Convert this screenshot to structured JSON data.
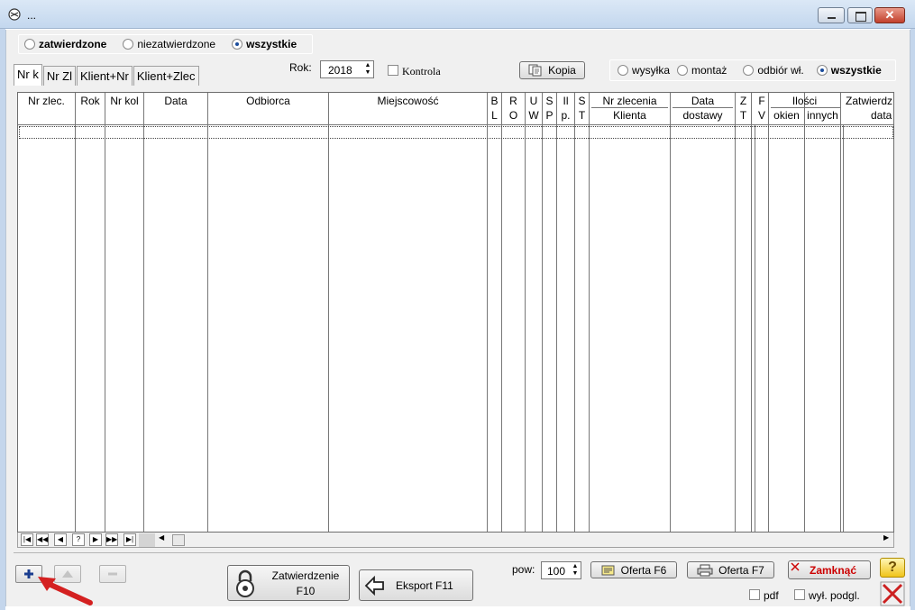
{
  "window": {
    "title": "..."
  },
  "approval_filter": {
    "options": [
      {
        "label": "zatwierdzone",
        "selected": false,
        "bold": true
      },
      {
        "label": "niezatwierdzone",
        "selected": false,
        "bold": false
      },
      {
        "label": "wszystkie",
        "selected": true,
        "bold": true
      }
    ]
  },
  "tabs": [
    "Nr k",
    "Nr Zl",
    "Klient+Nr",
    "Klient+Zlec"
  ],
  "active_tab": "Nr k",
  "year": {
    "label": "Rok:",
    "value": "2018"
  },
  "kontrola": {
    "label": "Kontrola",
    "checked": false
  },
  "kopia_button": "Kopia",
  "delivery_filter": {
    "options": [
      {
        "label": "wysyłka",
        "selected": false
      },
      {
        "label": "montaż",
        "selected": false
      },
      {
        "label": "odbiór wł.",
        "selected": false
      },
      {
        "label": "wszystkie",
        "selected": true
      }
    ]
  },
  "table": {
    "columns": [
      {
        "l1": "Nr zlec.",
        "l2": ""
      },
      {
        "l1": "Rok",
        "l2": ""
      },
      {
        "l1": "Nr kol",
        "l2": ""
      },
      {
        "l1": "Data",
        "l2": ""
      },
      {
        "l1": "Odbiorca",
        "l2": ""
      },
      {
        "l1": "Miejscowość",
        "l2": ""
      },
      {
        "l1": "B",
        "l2": "L"
      },
      {
        "l1": "R",
        "l2": "O"
      },
      {
        "l1": "U",
        "l2": "W"
      },
      {
        "l1": "S",
        "l2": "P"
      },
      {
        "l1": "Il",
        "l2": "p."
      },
      {
        "l1": "S",
        "l2": "T"
      },
      {
        "l1": "Nr zlecenia",
        "l2": "Klienta"
      },
      {
        "l1": "Data",
        "l2": "dostawy"
      },
      {
        "l1": "Z",
        "l2": "T"
      },
      {
        "l1": "F",
        "l2": "V"
      },
      {
        "l1": "Ilości",
        "l2": "okien"
      },
      {
        "l1": "",
        "l2": "innych"
      },
      {
        "l1": "Zatwierdz",
        "l2": "data"
      }
    ],
    "rows": []
  },
  "navigator": [
    "|◀",
    "◀◀",
    "◀",
    "?",
    "▶",
    "▶▶",
    "▶|"
  ],
  "footer": {
    "zatwierdzenie_label": "Zatwierdzenie",
    "zatwierdzenie_key": "F10",
    "eksport_label": "Eksport F11",
    "pow_label": "pow:",
    "pow_value": "100",
    "oferta_f6": "Oferta F6",
    "oferta_f7": "Oferta F7",
    "zamknac": "Zamknąć",
    "pdf_label": "pdf",
    "pdf_checked": false,
    "wyl_podgl_label": "wył. podgl.",
    "wyl_podgl_checked": false,
    "help_symbol": "?"
  },
  "colors": {
    "zamknac_text": "#cc0000",
    "plus_icon": "#1a3d8f",
    "arrow": "#d42020"
  }
}
